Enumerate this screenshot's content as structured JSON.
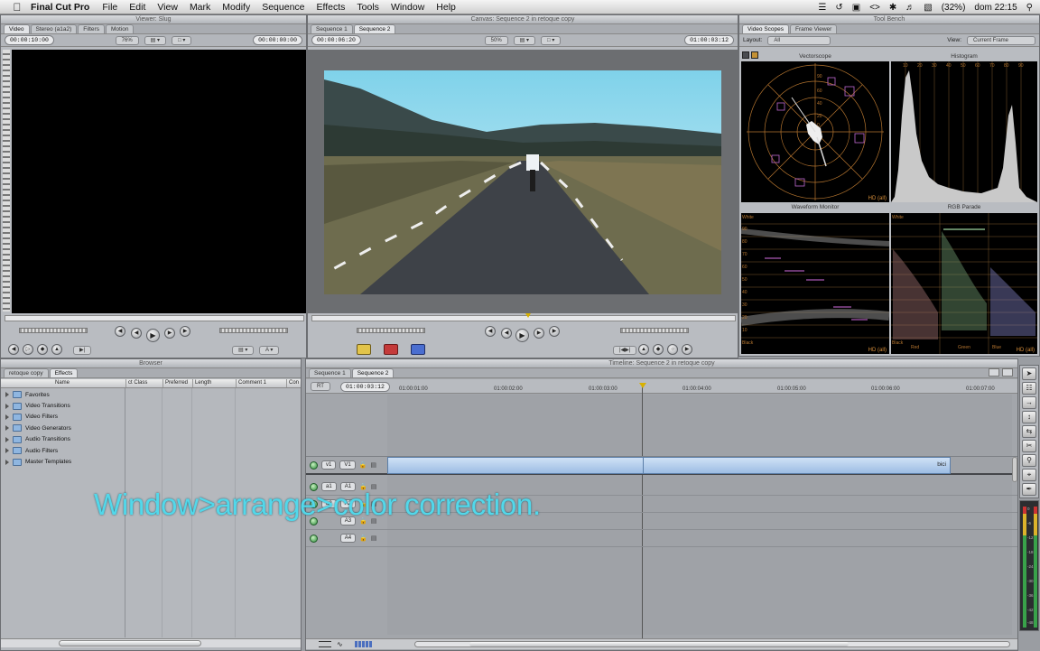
{
  "menubar": {
    "app": "Final Cut Pro",
    "items": [
      "File",
      "Edit",
      "View",
      "Mark",
      "Modify",
      "Sequence",
      "Effects",
      "Tools",
      "Window",
      "Help"
    ],
    "battery": "(32%)",
    "clock": "dom 22:15"
  },
  "viewer": {
    "title": "Viewer: Slug",
    "tabs": [
      "Video",
      "Stereo (a1a2)",
      "Filters",
      "Motion"
    ],
    "timecode_left": "00:00:10:00",
    "zoom": "76%",
    "timecode_right": "00:00:00:00"
  },
  "canvas": {
    "title": "Canvas: Sequence 2 in retoque copy",
    "tabs": [
      "Sequence 1",
      "Sequence 2"
    ],
    "timecode_left": "00:00:06:20",
    "zoom": "50%",
    "timecode_right": "01:00:03:12"
  },
  "toolbench": {
    "title": "Tool Bench",
    "tabs": [
      "Video Scopes",
      "Frame Viewer"
    ],
    "layout_label": "Layout:",
    "layout_value": "All",
    "view_label": "View:",
    "view_value": "Current Frame",
    "vectorscope": "Vectorscope",
    "histogram": "Histogram",
    "histogram_ticks": [
      "10",
      "20",
      "30",
      "40",
      "50",
      "60",
      "70",
      "80",
      "90"
    ],
    "waveform": "Waveform Monitor",
    "rgb_parade": "RGB Parade",
    "hd_label": "HD (all)",
    "white_label": "White",
    "black_label": "Black",
    "wf_ticks": [
      "90",
      "80",
      "70",
      "60",
      "50",
      "40",
      "30",
      "20",
      "10"
    ],
    "parade_channels": [
      "Red",
      "Green",
      "Blue"
    ],
    "vec_ring_labels": [
      "90",
      "60",
      "40",
      "20",
      "0"
    ]
  },
  "browser": {
    "title": "Browser",
    "tabs": [
      "retoque copy",
      "Effects"
    ],
    "columns": [
      "Name",
      "ct Class",
      "Preferred",
      "Length",
      "Comment 1",
      "Con"
    ],
    "items": [
      "Favorites",
      "Video Transitions",
      "Video Filters",
      "Video Generators",
      "Audio Transitions",
      "Audio Filters",
      "Master Templates"
    ]
  },
  "timeline": {
    "title": "Timeline: Sequence 2 in retoque copy",
    "tabs": [
      "Sequence 1",
      "Sequence 2"
    ],
    "rt": "RT",
    "timecode": "01:00:03:12",
    "ruler": [
      "01:00:01:00",
      "01:00:02:00",
      "01:00:03:00",
      "01:00:04:00",
      "01:00:05:00",
      "01:00:06:00",
      "01:00:07:00"
    ],
    "video_track_src": "v1",
    "video_track_dst": "V1",
    "clip_name": "bici",
    "audio_tracks": [
      {
        "src": "a1",
        "dst": "A1"
      },
      {
        "src": "a2",
        "dst": "A2"
      },
      {
        "src": "",
        "dst": "A3"
      },
      {
        "src": "",
        "dst": "A4"
      }
    ]
  },
  "audio_meter": {
    "ticks": [
      "0",
      "-6",
      "-12",
      "-18",
      "-24",
      "-30",
      "-36",
      "-42",
      "-48"
    ]
  },
  "overlay_caption": "Window>arrange>color correction."
}
